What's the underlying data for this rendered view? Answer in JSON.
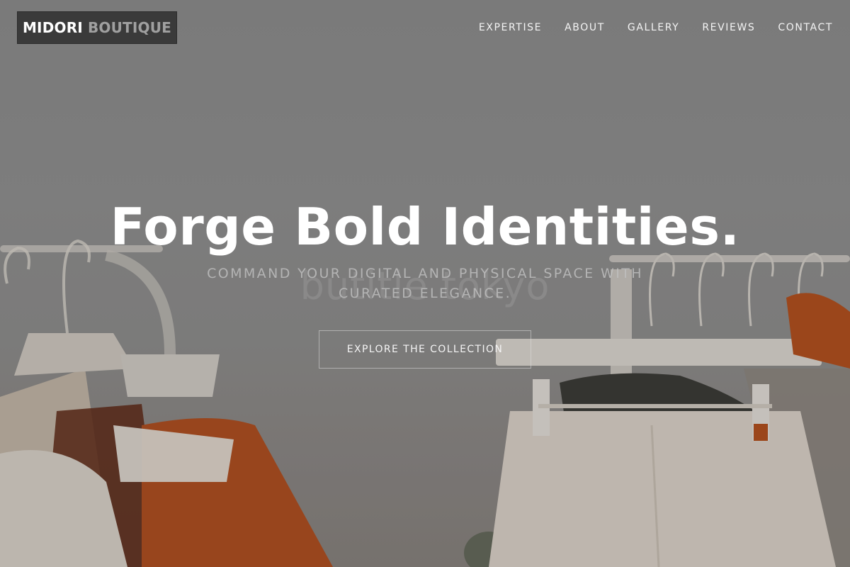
{
  "brand": {
    "name_main": "MIDORI",
    "name_sub": "BOUTIQUE"
  },
  "nav": {
    "items": [
      {
        "label": "EXPERTISE"
      },
      {
        "label": "ABOUT"
      },
      {
        "label": "GALLERY"
      },
      {
        "label": "REVIEWS"
      },
      {
        "label": "CONTACT"
      }
    ]
  },
  "hero": {
    "background_description_icon": "clothing-rack-photo",
    "watermark": "butitle tokyo",
    "title": "Forge Bold Identities.",
    "subtitle": "COMMAND YOUR DIGITAL AND PHYSICAL SPACE WITH CURATED ELEGANCE.",
    "cta_label": "EXPLORE THE COLLECTION"
  },
  "colors": {
    "logo_bg": "#3a3a3a",
    "logo_main": "#ffffff",
    "logo_sub": "#a0a0a0",
    "nav_text": "#f4f4f4",
    "title": "#ffffff",
    "accent_orange": "#b5541f"
  }
}
